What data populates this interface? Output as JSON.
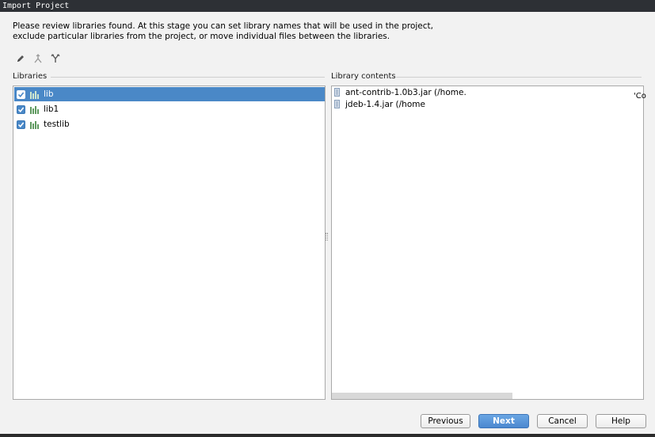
{
  "window": {
    "title": "Import Project"
  },
  "description": {
    "line1": "Please review libraries found. At this stage you can set library names that will be used in the project,",
    "line2": "exclude particular libraries from the project, or move individual files between the libraries."
  },
  "toolbar": {
    "icons": [
      "edit-pencil-icon",
      "merge-icon",
      "split-icon"
    ]
  },
  "libraries": {
    "label": "Libraries",
    "items": [
      {
        "name": "lib",
        "checked": true,
        "selected": true
      },
      {
        "name": "lib1",
        "checked": true,
        "selected": false
      },
      {
        "name": "testlib",
        "checked": true,
        "selected": false
      }
    ]
  },
  "library_contents": {
    "label": "Library contents",
    "items": [
      {
        "text": "ant-contrib-1.0b3.jar (/home."
      },
      {
        "text": "jdeb-1.4.jar (/home"
      }
    ],
    "truncated_right": "'Co"
  },
  "buttons": {
    "previous": "Previous",
    "next": "Next",
    "cancel": "Cancel",
    "help": "Help"
  },
  "colors": {
    "accent": "#4a88c7",
    "titlebar": "#2d3035",
    "dialog_bg": "#f2f2f2"
  }
}
